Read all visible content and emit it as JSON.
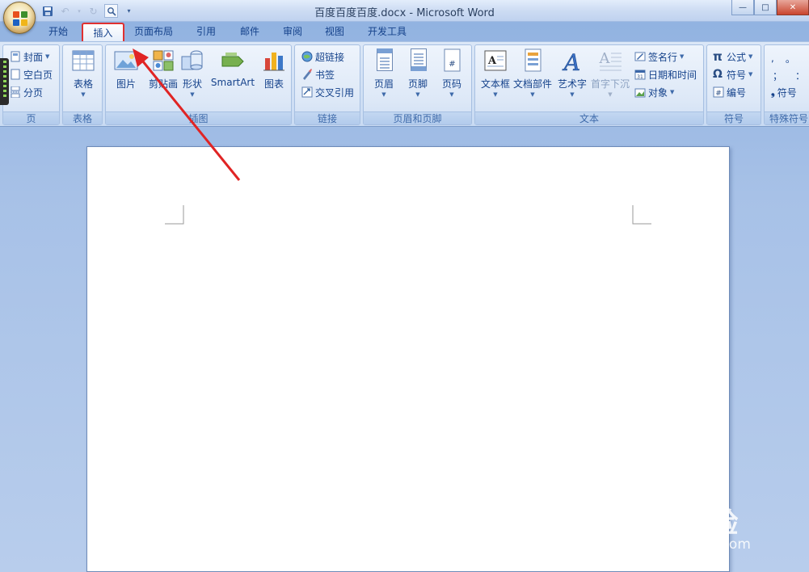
{
  "window": {
    "title": "百度百度百度.docx - Microsoft Word",
    "controls": {
      "minimize": "—",
      "restore": "□",
      "close": "✕"
    }
  },
  "tabs": [
    {
      "label": "开始",
      "active": false
    },
    {
      "label": "插入",
      "active": true
    },
    {
      "label": "页面布局",
      "active": false
    },
    {
      "label": "引用",
      "active": false
    },
    {
      "label": "邮件",
      "active": false
    },
    {
      "label": "审阅",
      "active": false
    },
    {
      "label": "视图",
      "active": false
    },
    {
      "label": "开发工具",
      "active": false
    }
  ],
  "ribbon": {
    "pages": {
      "label": "页",
      "items": [
        "封面",
        "空白页",
        "分页"
      ]
    },
    "tables": {
      "label": "表格",
      "table": "表格"
    },
    "illustrations": {
      "label": "插图",
      "picture": "图片",
      "clipart": "剪贴画",
      "shapes": "形状",
      "smartart": "SmartArt",
      "chart": "图表"
    },
    "links": {
      "label": "链接",
      "hyperlink": "超链接",
      "bookmark": "书签",
      "crossref": "交叉引用"
    },
    "header_footer": {
      "label": "页眉和页脚",
      "header": "页眉",
      "footer": "页脚",
      "page_number": "页码"
    },
    "text": {
      "label": "文本",
      "textbox": "文本框",
      "quickparts": "文档部件",
      "wordart": "艺术字",
      "dropcap": "首字下沉",
      "signature": "签名行",
      "datetime": "日期和时间",
      "object": "对象"
    },
    "symbols": {
      "label": "符号",
      "equation": "公式",
      "symbol": "符号",
      "number": "编号",
      "pi": "π",
      "omega": "Ω"
    },
    "special": {
      "label": "特殊符号",
      "symbol": "符号",
      "chars": [
        ",",
        "。",
        "；",
        "："
      ]
    }
  },
  "watermark": {
    "brand": "Bai 经验",
    "sub": "jingyan.baidu.com"
  },
  "colors": {
    "highlight": "#e03030",
    "arrow": "#e02424"
  }
}
